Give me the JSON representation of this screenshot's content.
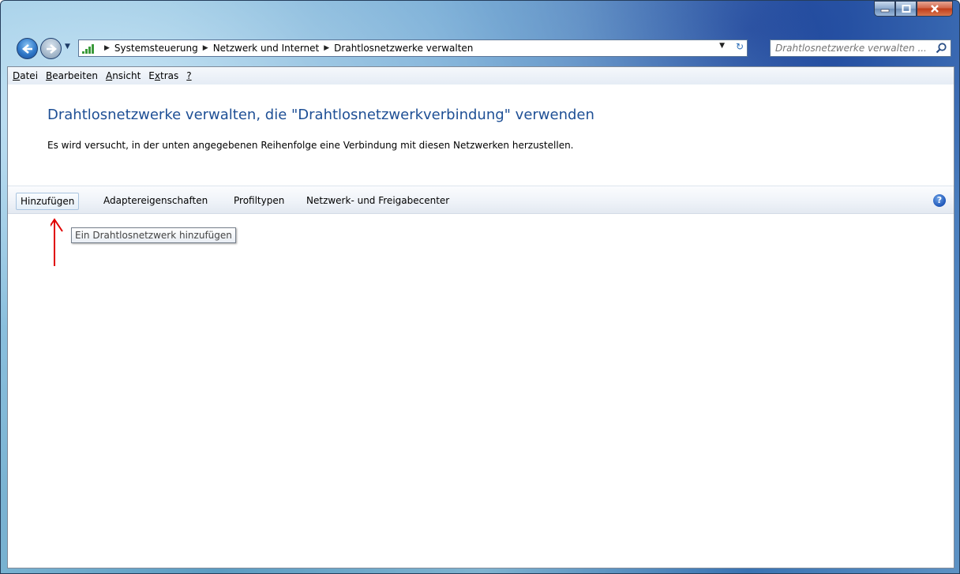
{
  "window": {
    "caption_buttons": [
      "minimize",
      "maximize",
      "close"
    ]
  },
  "navigation": {
    "breadcrumb": [
      "Systemsteuerung",
      "Netzwerk und Internet",
      "Drahtlosnetzwerke verwalten"
    ],
    "search_placeholder": "Drahtlosnetzwerke verwalten ..."
  },
  "menubar": {
    "items": [
      {
        "pre": "",
        "u": "D",
        "post": "atei"
      },
      {
        "pre": "",
        "u": "B",
        "post": "earbeiten"
      },
      {
        "pre": "",
        "u": "A",
        "post": "nsicht"
      },
      {
        "pre": "E",
        "u": "x",
        "post": "tras"
      },
      {
        "pre": "",
        "u": "?",
        "post": ""
      }
    ]
  },
  "content": {
    "title": "Drahtlosnetzwerke verwalten, die \"Drahtlosnetzwerkverbindung\" verwenden",
    "description": "Es wird versucht, in der unten angegebenen Reihenfolge eine Verbindung mit diesen Netzwerken herzustellen."
  },
  "commandbar": {
    "items": [
      "Hinzufügen",
      "Adaptereigenschaften",
      "Profiltypen",
      "Netzwerk- und Freigabecenter"
    ],
    "help": "?"
  },
  "tooltip": {
    "text": "Ein Drahtlosnetzwerk hinzufügen"
  },
  "colors": {
    "title_blue": "#1e4f95",
    "annotation_red": "#e00000"
  },
  "icons": [
    "back-arrow-icon",
    "forward-arrow-icon",
    "network-icon",
    "refresh-icon",
    "search-icon",
    "help-icon"
  ]
}
